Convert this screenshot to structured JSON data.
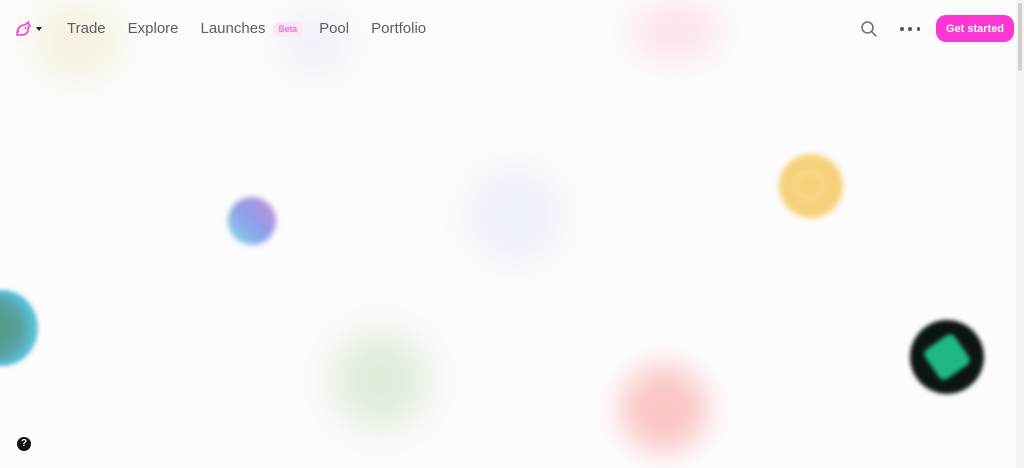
{
  "nav": {
    "links": [
      "Trade",
      "Explore",
      "Launches",
      "Pool",
      "Portfolio"
    ],
    "beta_badge": "Beta",
    "cta_label": "Get started"
  },
  "icons": {
    "logo": "uniswap-unicorn-icon",
    "logo_menu": "caret-down-icon",
    "search": "search-icon",
    "more": "more-horizontal-icon",
    "help": "help-icon"
  },
  "help_label": "?",
  "colors": {
    "brand": "#fc37d3",
    "beta_bg": "#fde6f5",
    "beta_text": "#f24fb7",
    "nav_text": "#5e5e5e",
    "background": "#fcfcfc"
  }
}
